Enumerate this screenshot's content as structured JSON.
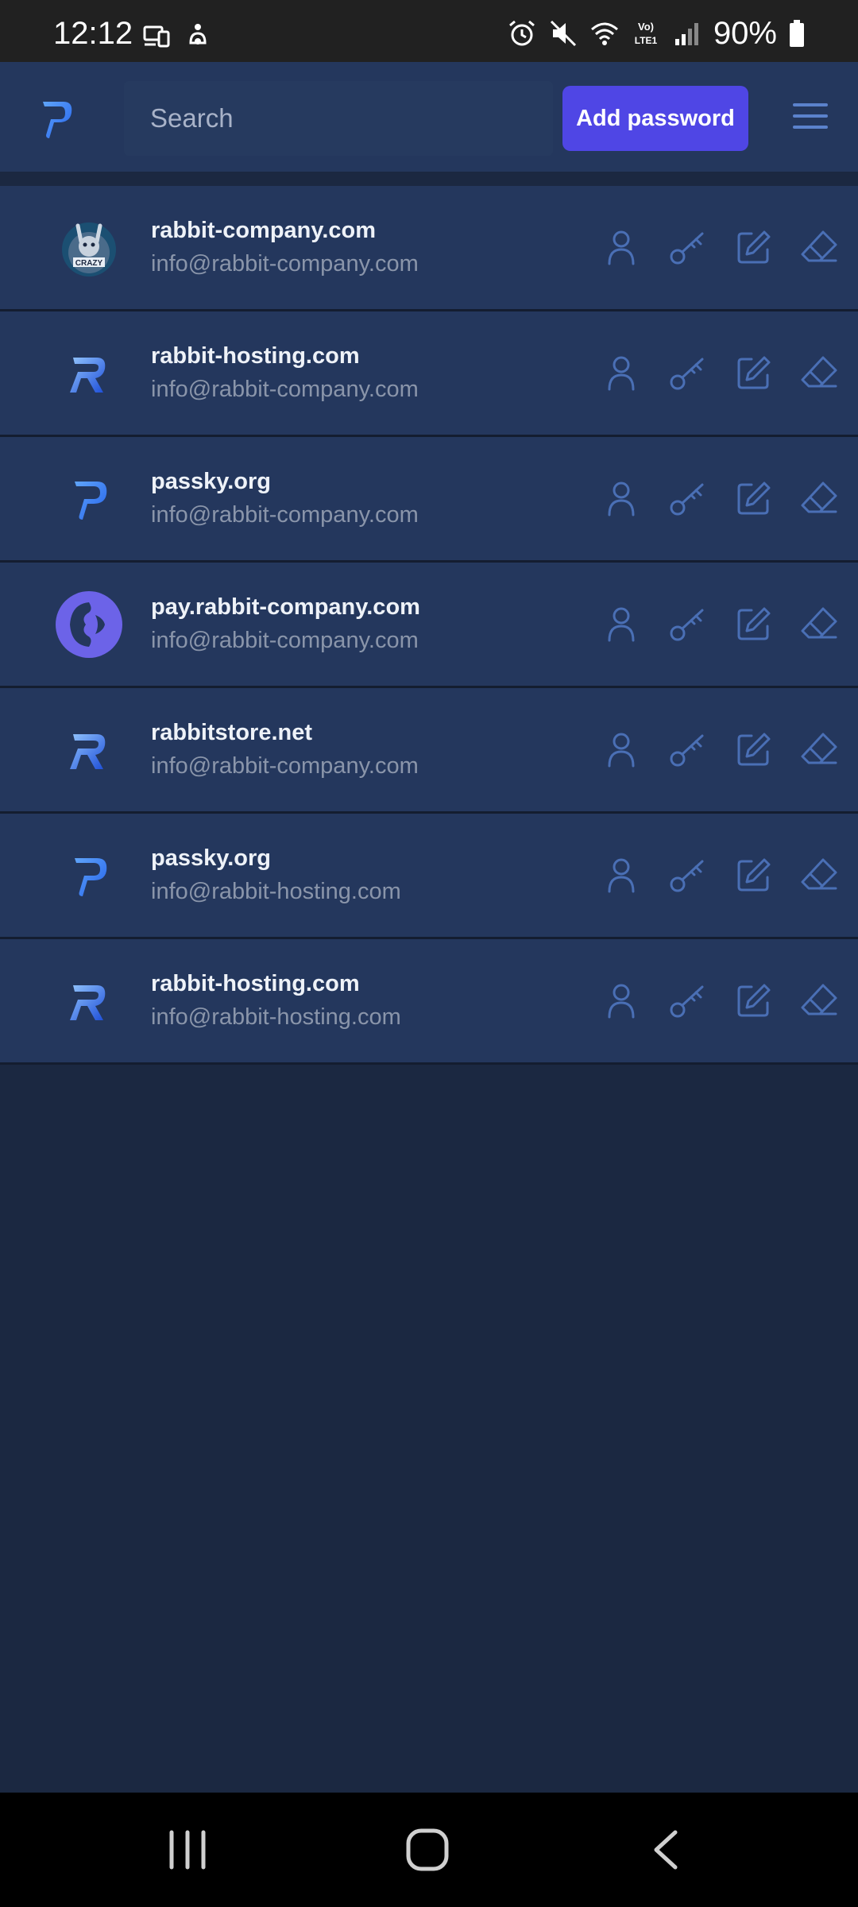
{
  "status_bar": {
    "time": "12:12",
    "battery": "90%",
    "network": "LTE1"
  },
  "header": {
    "logo_icon": "passky-logo-icon",
    "search_placeholder": "Search",
    "add_button_label": "Add password",
    "menu_icon": "hamburger-menu-icon"
  },
  "passwords": [
    {
      "website": "rabbit-company.com",
      "username": "info@rabbit-company.com",
      "icon": "crazy-rabbit-logo"
    },
    {
      "website": "rabbit-hosting.com",
      "username": "info@rabbit-company.com",
      "icon": "rabbit-hosting-logo"
    },
    {
      "website": "passky.org",
      "username": "info@rabbit-company.com",
      "icon": "passky-logo"
    },
    {
      "website": "pay.rabbit-company.com",
      "username": "info@rabbit-company.com",
      "icon": "rabbit-pay-logo"
    },
    {
      "website": "rabbitstore.net",
      "username": "info@rabbit-company.com",
      "icon": "rabbitstore-logo"
    },
    {
      "website": "passky.org",
      "username": "info@rabbit-hosting.com",
      "icon": "passky-logo"
    },
    {
      "website": "rabbit-hosting.com",
      "username": "info@rabbit-hosting.com",
      "icon": "rabbit-hosting-logo"
    }
  ],
  "row_actions": [
    "copy-username-icon",
    "copy-password-icon",
    "edit-icon",
    "delete-icon"
  ],
  "colors": {
    "background": "#1b2841",
    "header": "#24375d",
    "row": "#24375d",
    "accent": "#4f46e5",
    "action_icon": "#4a6fb5",
    "muted_text": "#8a95aa"
  }
}
